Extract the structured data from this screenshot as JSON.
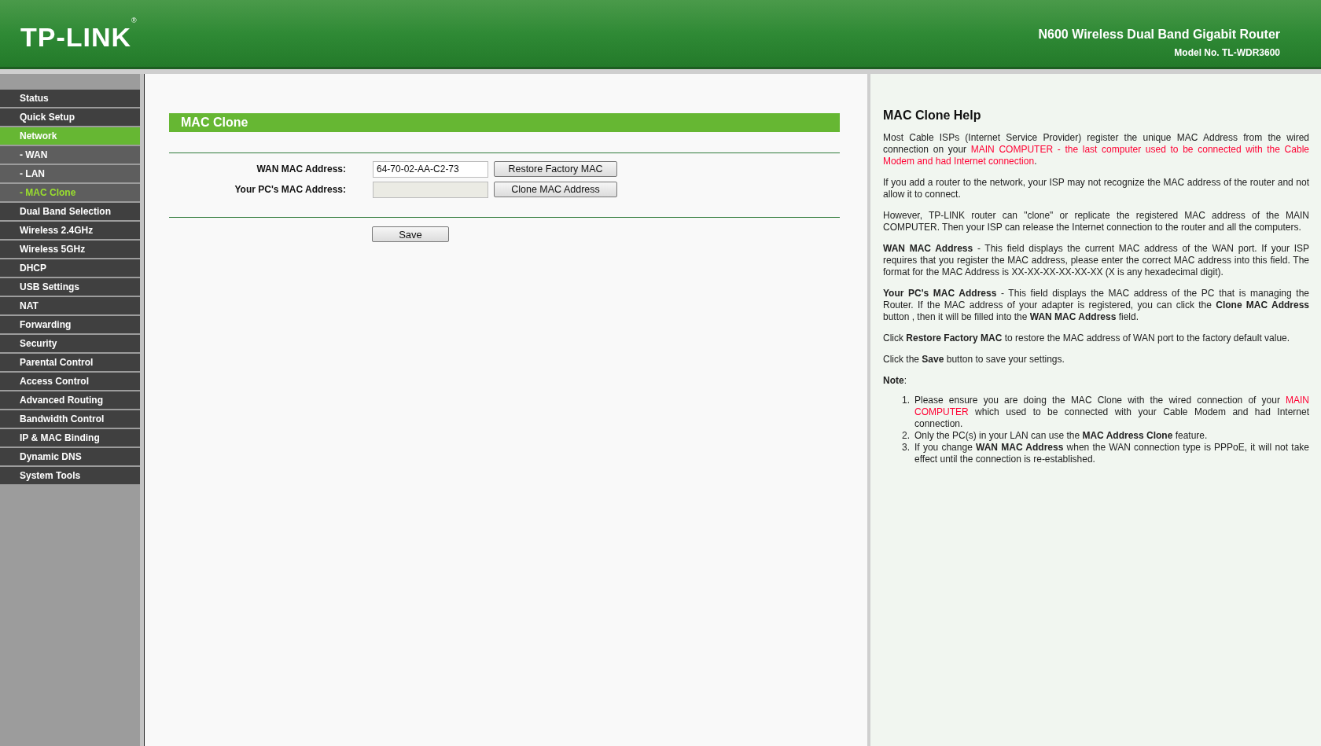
{
  "header": {
    "logo": "TP-LINK",
    "logo_mark": "®",
    "product": "N600 Wireless Dual Band Gigabit Router",
    "model": "Model No. TL-WDR3600"
  },
  "sidebar": {
    "items": [
      {
        "label": "Status",
        "kind": "section",
        "selected": false
      },
      {
        "label": "Quick Setup",
        "kind": "section",
        "selected": false
      },
      {
        "label": "Network",
        "kind": "section",
        "selected": true
      },
      {
        "label": "- WAN",
        "kind": "sub",
        "selected": false
      },
      {
        "label": "- LAN",
        "kind": "sub",
        "selected": false
      },
      {
        "label": "- MAC Clone",
        "kind": "sub",
        "selected": true
      },
      {
        "label": "Dual Band Selection",
        "kind": "section",
        "selected": false
      },
      {
        "label": "Wireless 2.4GHz",
        "kind": "section",
        "selected": false
      },
      {
        "label": "Wireless 5GHz",
        "kind": "section",
        "selected": false
      },
      {
        "label": "DHCP",
        "kind": "section",
        "selected": false
      },
      {
        "label": "USB Settings",
        "kind": "section",
        "selected": false
      },
      {
        "label": "NAT",
        "kind": "section",
        "selected": false
      },
      {
        "label": "Forwarding",
        "kind": "section",
        "selected": false
      },
      {
        "label": "Security",
        "kind": "section",
        "selected": false
      },
      {
        "label": "Parental Control",
        "kind": "section",
        "selected": false
      },
      {
        "label": "Access Control",
        "kind": "section",
        "selected": false
      },
      {
        "label": "Advanced Routing",
        "kind": "section",
        "selected": false
      },
      {
        "label": "Bandwidth Control",
        "kind": "section",
        "selected": false
      },
      {
        "label": "IP & MAC Binding",
        "kind": "section",
        "selected": false
      },
      {
        "label": "Dynamic DNS",
        "kind": "section",
        "selected": false
      },
      {
        "label": "System Tools",
        "kind": "section",
        "selected": false
      }
    ]
  },
  "main": {
    "title": "MAC Clone",
    "fields": [
      {
        "label": "WAN MAC Address:",
        "value": "64-70-02-AA-C2-73",
        "disabled": false,
        "button": "Restore Factory MAC"
      },
      {
        "label": "Your PC's MAC Address:",
        "disabled": true,
        "button": "Clone MAC Address"
      }
    ],
    "save_button": "Save"
  },
  "help": {
    "title": "MAC Clone Help",
    "paragraphs": [
      [
        {
          "kind": "plain",
          "text": "Most Cable ISPs (Internet Service Provider) register the unique MAC Address from the wired connection on your "
        },
        {
          "kind": "red",
          "text": "MAIN COMPUTER - the last computer used to be connected with the Cable Modem and had Internet connection"
        },
        {
          "kind": "plain",
          "text": "."
        }
      ],
      [
        {
          "kind": "plain",
          "text": "If you add a router to the network, your ISP may not recognize the MAC address of the router and not allow it to connect."
        }
      ],
      [
        {
          "kind": "plain",
          "text": "However, TP-LINK router can \"clone\" or replicate the registered MAC address of the MAIN COMPUTER. Then your ISP can release the Internet connection to the router and all the computers."
        }
      ],
      [
        {
          "kind": "bold",
          "text": "WAN MAC Address"
        },
        {
          "kind": "plain",
          "text": " - This field displays the current MAC address of the WAN port. If your ISP requires that you register the MAC address, please enter the correct MAC address into this field. The format for the MAC Address is XX-XX-XX-XX-XX-XX (X is any hexadecimal digit)."
        }
      ],
      [
        {
          "kind": "bold",
          "text": "Your PC's MAC Address"
        },
        {
          "kind": "plain",
          "text": " - This field displays the MAC address of the PC that is managing the Router. If the MAC address of your adapter is registered, you can click the "
        },
        {
          "kind": "bold",
          "text": "Clone MAC Address"
        },
        {
          "kind": "plain",
          "text": " button , then it will be filled into the "
        },
        {
          "kind": "bold",
          "text": "WAN MAC Address"
        },
        {
          "kind": "plain",
          "text": " field."
        }
      ],
      [
        {
          "kind": "plain",
          "text": "Click "
        },
        {
          "kind": "bold",
          "text": "Restore Factory MAC"
        },
        {
          "kind": "plain",
          "text": " to restore the MAC address of WAN port to the factory default value."
        }
      ],
      [
        {
          "kind": "plain",
          "text": "Click the "
        },
        {
          "kind": "bold",
          "text": "Save"
        },
        {
          "kind": "plain",
          "text": " button to save your settings."
        }
      ],
      [
        {
          "kind": "bold",
          "text": "Note"
        },
        {
          "kind": "plain",
          "text": ":"
        }
      ]
    ],
    "notes": [
      {
        "number": "1.",
        "segments": [
          {
            "kind": "plain",
            "text": "Please ensure you are doing the MAC Clone with the wired connection of your "
          },
          {
            "kind": "red",
            "text": "MAIN COMPUTER"
          },
          {
            "kind": "plain",
            "text": " which used to be connected with your Cable Modem and had Internet connection."
          }
        ]
      },
      {
        "number": "2.",
        "segments": [
          {
            "kind": "plain",
            "text": "Only the PC(s) in your LAN can use the "
          },
          {
            "kind": "bold",
            "text": "MAC Address Clone"
          },
          {
            "kind": "plain",
            "text": " feature."
          }
        ]
      },
      {
        "number": "3.",
        "segments": [
          {
            "kind": "plain",
            "text": "If you change "
          },
          {
            "kind": "bold",
            "text": "WAN MAC Address"
          },
          {
            "kind": "plain",
            "text": " when the WAN connection type is PPPoE, it will not take effect until the connection is re-established."
          }
        ]
      }
    ]
  }
}
